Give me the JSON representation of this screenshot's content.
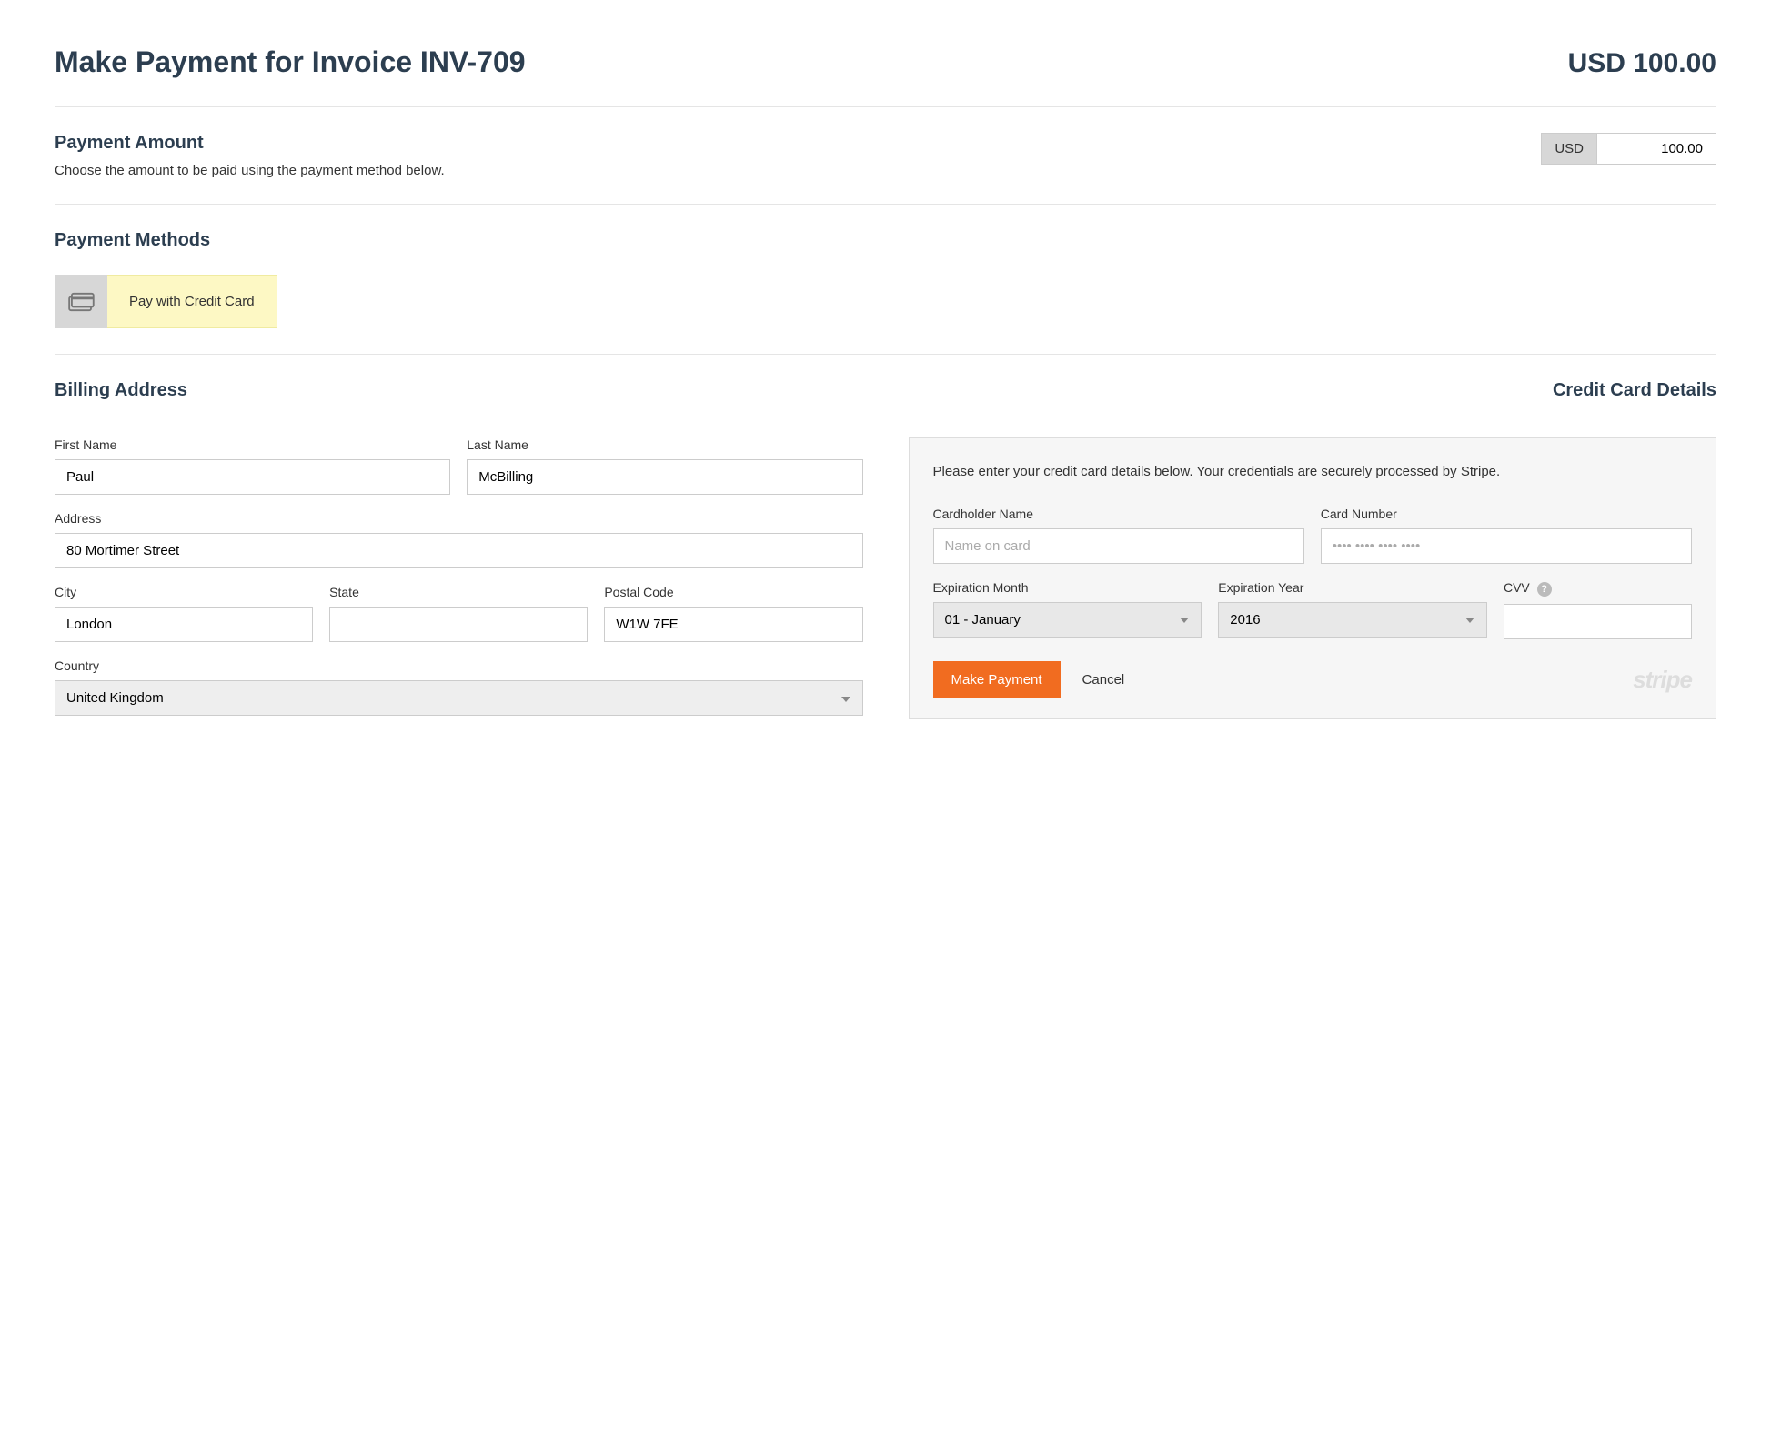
{
  "header": {
    "title": "Make Payment for Invoice INV-709",
    "total": "USD 100.00"
  },
  "payment_amount": {
    "title": "Payment Amount",
    "desc": "Choose the amount to be paid using the payment method below.",
    "currency": "USD",
    "value": "100.00"
  },
  "payment_methods": {
    "title": "Payment Methods",
    "selected_label": "Pay with Credit Card"
  },
  "billing": {
    "title": "Billing Address",
    "first_name_label": "First Name",
    "first_name": "Paul",
    "last_name_label": "Last Name",
    "last_name": "McBilling",
    "address_label": "Address",
    "address": "80 Mortimer Street",
    "city_label": "City",
    "city": "London",
    "state_label": "State",
    "state": "",
    "postal_label": "Postal Code",
    "postal": "W1W 7FE",
    "country_label": "Country",
    "country": "United Kingdom"
  },
  "card": {
    "title": "Credit Card Details",
    "intro": "Please enter your credit card details below. Your credentials are securely processed by Stripe.",
    "name_label": "Cardholder Name",
    "name_placeholder": "Name on card",
    "number_label": "Card Number",
    "number_placeholder": "•••• •••• •••• ••••",
    "exp_month_label": "Expiration Month",
    "exp_month": "01 - January",
    "exp_year_label": "Expiration Year",
    "exp_year": "2016",
    "cvv_label": "CVV",
    "submit": "Make Payment",
    "cancel": "Cancel",
    "processor": "stripe"
  }
}
